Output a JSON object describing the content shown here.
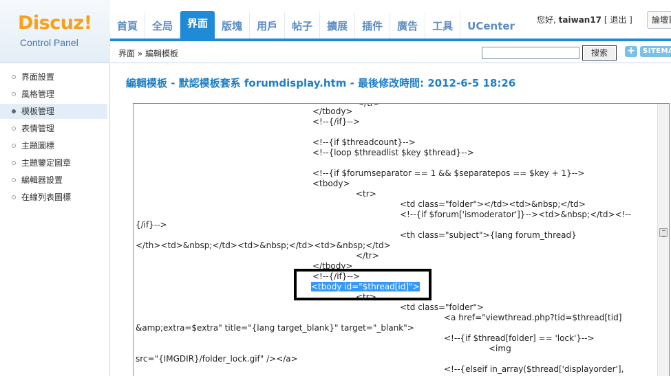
{
  "header": {
    "logo_main": "Discuz",
    "logo_excl": "!",
    "logo_sub": "Control Panel",
    "nav": [
      {
        "label": "首頁"
      },
      {
        "label": "全局"
      },
      {
        "label": "界面"
      },
      {
        "label": "版塊"
      },
      {
        "label": "用戶"
      },
      {
        "label": "帖子"
      },
      {
        "label": "擴展"
      },
      {
        "label": "插件"
      },
      {
        "label": "廣告"
      },
      {
        "label": "工具"
      },
      {
        "label": "UCenter"
      }
    ],
    "active_nav": "界面",
    "greeting": "您好,",
    "username": "taiwan17",
    "logout": "[ 退出 ]",
    "forum_link": "論壇首"
  },
  "subbar": {
    "breadcrumb": "界面 » 編輯模板",
    "search_value": "",
    "search_button": "搜索",
    "plus_label": "+",
    "sitemap_label": "SITEMAP"
  },
  "sidebar": {
    "items": [
      {
        "label": "界面設置"
      },
      {
        "label": "風格管理"
      },
      {
        "label": "模板管理"
      },
      {
        "label": "表情管理"
      },
      {
        "label": "主題圖標"
      },
      {
        "label": "主題鑒定圖章"
      },
      {
        "label": "編輯器設置"
      },
      {
        "label": "在線列表圖標"
      }
    ],
    "active": "模板管理"
  },
  "main": {
    "title": "編輯模板 - 默認模板套系 forumdisplay.htm - 最後修改時間: 2012-6-5 18:26"
  },
  "editor": {
    "lines": [
      "</tr>",
      "</tbody>",
      "<!--{/if}-->",
      "<!--{if $threadcount}-->",
      "<!--{loop $threadlist $key $thread}-->",
      "<!--{if $forumseparator == 1 && $separatepos == $key + 1}-->",
      "<tbody>",
      "<tr>",
      "<td class=\"folder\"></td><td>&nbsp;</td>",
      "<!--{if $forum['ismoderator']}--><td>&nbsp;</td><!--",
      "{/if}-->",
      "<th class=\"subject\">{lang forum_thread}",
      "</th><td>&nbsp;</td><td>&nbsp;</td><td>&nbsp;</td>",
      "</tr>",
      "</tbody>",
      "<!--{/if}-->",
      "<tbody id=\"$thread[id]\">",
      "<tr>",
      "<td class=\"folder\">",
      "<a href=\"viewthread.php?tid=$thread[tid]",
      "&amp;extra=$extra\" title=\"{lang target_blank}\" target=\"_blank\">",
      "<!--{if $thread[folder] == 'lock'}-->",
      "<img",
      "src=\"{IMGDIR}/folder_lock.gif\" /></a>",
      "<!--{elseif in_array($thread['displayorder'],"
    ],
    "selected_line": "<tbody id=\"$thread[id]\">"
  }
}
